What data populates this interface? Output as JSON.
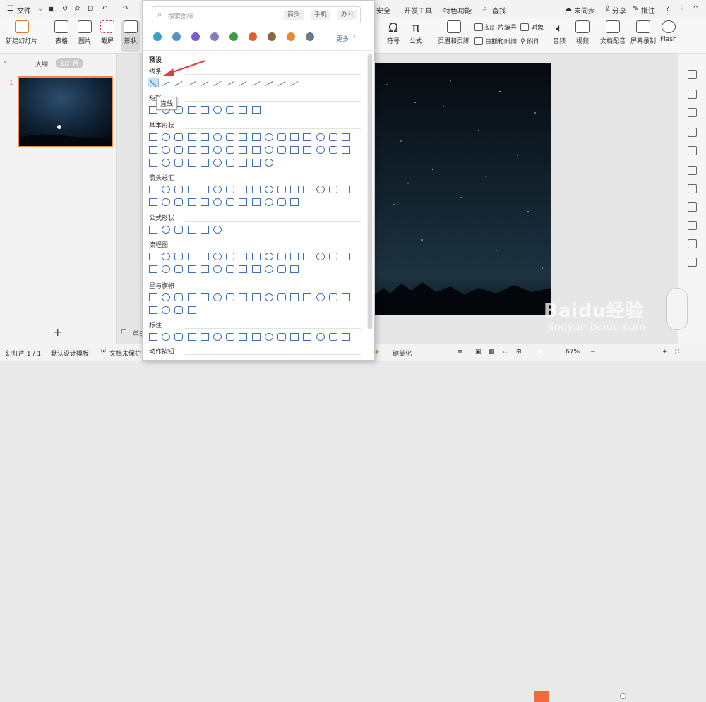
{
  "menu": {
    "hamburger_label": "文件",
    "tabs_right": [
      {
        "label": "安全"
      },
      {
        "label": "开发工具"
      },
      {
        "label": "特色功能"
      },
      {
        "label": "查找"
      }
    ],
    "sync_status": "未同步",
    "share": "分享",
    "comment": "批注"
  },
  "ribbon": {
    "left_buttons": [
      {
        "label": "新建幻灯片",
        "icon": "new-slide-icon"
      },
      {
        "label": "表格",
        "icon": "table-icon"
      },
      {
        "label": "图片",
        "icon": "picture-icon"
      },
      {
        "label": "截屏",
        "icon": "screenshot-icon"
      },
      {
        "label": "形状",
        "icon": "shape-icon"
      }
    ],
    "right_buttons": [
      {
        "label": "符号",
        "icon": "omega-icon"
      },
      {
        "label": "公式",
        "icon": "pi-icon"
      },
      {
        "label": "页眉和页脚",
        "icon": "header-footer-icon"
      },
      {
        "label": "音频",
        "icon": "audio-icon"
      },
      {
        "label": "视频",
        "icon": "video-icon"
      },
      {
        "label": "文档配音",
        "icon": "dub-icon"
      },
      {
        "label": "屏幕录制",
        "icon": "record-icon"
      },
      {
        "label": "Flash",
        "icon": "flash-icon"
      }
    ],
    "small_buttons": [
      {
        "label": "幻灯片编号"
      },
      {
        "label": "对象"
      },
      {
        "label": "日期和时间"
      },
      {
        "label": "附件"
      }
    ]
  },
  "left_panel": {
    "tab_outline": "大纲",
    "tab_slides": "幻灯片",
    "slide_number": "1",
    "add_icon": "plus-icon"
  },
  "shape_panel": {
    "search_placeholder": "搜索图标",
    "search_tags": [
      "箭头",
      "手机",
      "办公"
    ],
    "more_label": "更多",
    "preset_label": "预设",
    "tooltip": "直线",
    "sections": [
      {
        "name": "线条",
        "count": 12
      },
      {
        "name": "矩形",
        "count": 9
      },
      {
        "name": "基本形状",
        "count": 42
      },
      {
        "name": "箭头总汇",
        "count": 28
      },
      {
        "name": "公式形状",
        "count": 6
      },
      {
        "name": "流程图",
        "count": 28
      },
      {
        "name": "星与旗帜",
        "count": 20
      },
      {
        "name": "标注",
        "count": 16
      },
      {
        "name": "动作按钮",
        "count": 0
      }
    ]
  },
  "statusbar": {
    "slide_info": "幻灯片 1 / 1",
    "template": "默认设计模板",
    "doc_protect": "文档未保护",
    "beautify": "一键美化",
    "zoom": "67%",
    "notes_label": "单击"
  },
  "watermark": {
    "brand": "Baidu经验",
    "url": "jingyan.baidu.com"
  },
  "colors": {
    "accent": "#f08a4b",
    "highlight": "#c7e0f4",
    "arrow": "#e53935",
    "shape_stroke": "#3f6fb0"
  }
}
